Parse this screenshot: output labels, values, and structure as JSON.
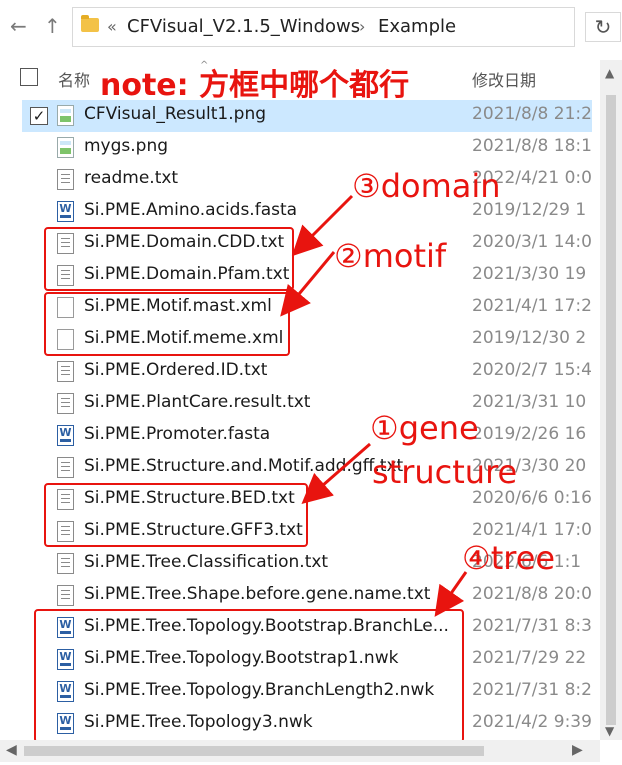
{
  "address": {
    "chevron": "«",
    "crumbs": [
      "CFVisual_V2.1.5_Windows",
      "Example"
    ],
    "separator": "›",
    "refresh_glyph": "↻"
  },
  "nav": {
    "back": "←",
    "up": "↑"
  },
  "header": {
    "name_col": "名称",
    "date_col": "修改日期",
    "sort_glyph": "^"
  },
  "note_text": "note: 方框中哪个都行",
  "files": [
    {
      "name": "CFVisual_Result1.png",
      "date": "2021/8/8 21:2",
      "icon": "png",
      "selected": true,
      "check": "✓"
    },
    {
      "name": "mygs.png",
      "date": "2021/8/8 18:1",
      "icon": "png"
    },
    {
      "name": "readme.txt",
      "date": "2022/4/21 0:0",
      "icon": "txt"
    },
    {
      "name": "Si.PME.Amino.acids.fasta",
      "date": "2019/12/29 1",
      "icon": "wm"
    },
    {
      "name": "Si.PME.Domain.CDD.txt",
      "date": "2020/3/1 14:0",
      "icon": "txt"
    },
    {
      "name": "Si.PME.Domain.Pfam.txt",
      "date": "2021/3/30 19",
      "icon": "txt"
    },
    {
      "name": "Si.PME.Motif.mast.xml",
      "date": "2021/4/1 17:2",
      "icon": "xml"
    },
    {
      "name": "Si.PME.Motif.meme.xml",
      "date": "2019/12/30 2",
      "icon": "xml"
    },
    {
      "name": "Si.PME.Ordered.ID.txt",
      "date": "2020/2/7 15:4",
      "icon": "txt"
    },
    {
      "name": "Si.PME.PlantCare.result.txt",
      "date": "2021/3/31 10",
      "icon": "txt"
    },
    {
      "name": "Si.PME.Promoter.fasta",
      "date": "2019/2/26 16",
      "icon": "wm"
    },
    {
      "name": "Si.PME.Structure.and.Motif.add.gff.txt",
      "date": "2021/3/30 20",
      "icon": "txt"
    },
    {
      "name": "Si.PME.Structure.BED.txt",
      "date": "2020/6/6 0:16",
      "icon": "txt"
    },
    {
      "name": "Si.PME.Structure.GFF3.txt",
      "date": "2021/4/1 17:0",
      "icon": "txt"
    },
    {
      "name": "Si.PME.Tree.Classification.txt",
      "date": "2022/6/6 1:1",
      "icon": "txt"
    },
    {
      "name": "Si.PME.Tree.Shape.before.gene.name.txt",
      "date": "2021/8/8 20:0",
      "icon": "txt"
    },
    {
      "name": "Si.PME.Tree.Topology.Bootstrap.BranchLe...",
      "date": "2021/7/31 8:3",
      "icon": "wm"
    },
    {
      "name": "Si.PME.Tree.Topology.Bootstrap1.nwk",
      "date": "2021/7/29 22",
      "icon": "wm"
    },
    {
      "name": "Si.PME.Tree.Topology.BranchLength2.nwk",
      "date": "2021/7/31 8:2",
      "icon": "wm"
    },
    {
      "name": "Si.PME.Tree.Topology3.nwk",
      "date": "2021/4/2 9:39",
      "icon": "wm"
    }
  ],
  "annotations": {
    "domain": "③domain",
    "motif": "②motif",
    "gene": "①gene",
    "structure": "structure",
    "tree": "④tree"
  },
  "scroll": {
    "up": "▲",
    "down": "▼",
    "left": "◀",
    "right": "▶"
  },
  "colors": {
    "annotation": "#e8140f",
    "selection": "#cce8ff"
  }
}
